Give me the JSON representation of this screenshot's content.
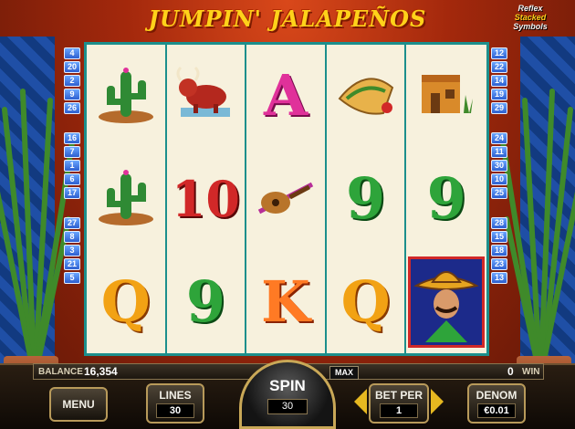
{
  "header": {
    "title": "JUMPIN' JALAPEÑOS",
    "badge": [
      "Reflex",
      "Stacked",
      "Symbols"
    ]
  },
  "paylines": {
    "left": [
      [
        4,
        20,
        2,
        9,
        26
      ],
      [
        16,
        7,
        1,
        6,
        17
      ],
      [
        27,
        8,
        3,
        21,
        5
      ]
    ],
    "right": [
      [
        12,
        22,
        14,
        19,
        29
      ],
      [
        24,
        11,
        30,
        10,
        25
      ],
      [
        28,
        15,
        18,
        23,
        13
      ]
    ]
  },
  "reels": [
    [
      "cactus",
      "cactus",
      "Q"
    ],
    [
      "bull",
      "10",
      "9"
    ],
    [
      "A",
      "guitar",
      "K"
    ],
    [
      "taco",
      "9",
      "Q"
    ],
    [
      "adobe-house",
      "9",
      "mariachi"
    ]
  ],
  "balance": {
    "label": "BALANCE",
    "value": "16,354"
  },
  "win": {
    "value": "0",
    "label": "WIN"
  },
  "controls": {
    "menu_label": "MENU",
    "lines_label": "LINES",
    "lines_value": "30",
    "spin_label": "SPIN",
    "spin_value": "30",
    "max_label": "MAX",
    "bet_label": "BET PER",
    "bet_value": "1",
    "denom_label": "DENOM",
    "denom_value": "€0.01"
  },
  "colors": {
    "reel_border": "#1c8f8c",
    "reel_bg": "#f7f1dd",
    "title": "#ffd21a",
    "arrow": "#e6b820"
  }
}
